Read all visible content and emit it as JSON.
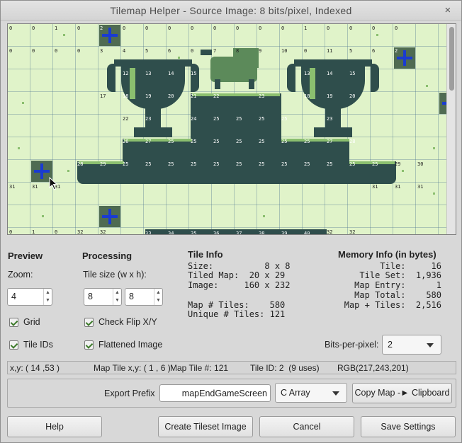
{
  "window": {
    "title": "Tilemap Helper  - Source Image: 8 bits/pixel, Indexed",
    "close_glyph": "×"
  },
  "preview": {
    "header": "Preview",
    "zoom_label": "Zoom:",
    "zoom_value": "4",
    "grid_label": "Grid",
    "grid_checked": true,
    "tile_ids_label": "Tile IDs",
    "tile_ids_checked": true
  },
  "processing": {
    "header": "Processing",
    "tile_size_label": "Tile size (w x h):",
    "tile_w": "8",
    "tile_h": "8",
    "check_flip_label": "Check Flip X/Y",
    "check_flip_checked": true,
    "flattened_label": "Flattened Image",
    "flattened_checked": true
  },
  "tile_info": {
    "header": "Tile Info",
    "lines": [
      "Size:          8 x 8",
      "Tiled Map:  20 x 29",
      "Image:     160 x 232",
      "",
      "Map # Tiles:    580",
      "Unique # Tiles: 121"
    ]
  },
  "memory_info": {
    "header": "Memory Info (in bytes)",
    "lines": [
      "Tile:     16",
      "Tile Set:  1,936",
      "Map Entry:      1",
      "Map Total:    580",
      "Map + Tiles:  2,516"
    ]
  },
  "bits_per_pixel": {
    "label": "Bits-per-pixel:",
    "value": "2"
  },
  "status": {
    "xy": "x,y: ( 14 ,53 )",
    "map_tile_xy": "Map Tile x,y: ( 1 , 6 )",
    "map_tile_num": "Map Tile #: 121",
    "tile_id": "Tile ID: 2  (9 uses)",
    "rgb": "RGB(217,243,201)"
  },
  "export": {
    "prefix_label": "Export Prefix",
    "prefix_value": "mapEndGameScreen",
    "format_value": "C Array",
    "copy_button": "Copy Map -► Clipboard"
  },
  "buttons": {
    "help": "Help",
    "create_tileset": "Create Tileset Image",
    "cancel": "Cancel",
    "save_settings": "Save Settings"
  },
  "tile_ids": {
    "row0": [
      "0",
      "0",
      "1",
      "0",
      "2",
      "0",
      "0",
      "0",
      "0",
      "0",
      "0",
      "0",
      "0",
      "1",
      "0",
      "0",
      "0",
      "0"
    ],
    "row1": [
      "0",
      "0",
      "0",
      "0",
      "3",
      "4",
      "5",
      "6",
      "0",
      "7",
      "8",
      "9",
      "10",
      "0",
      "11",
      "5",
      "6",
      "2"
    ],
    "row2_left": [
      "12",
      "13",
      "14",
      "15"
    ],
    "row2_right": [
      "13",
      "14",
      "15"
    ],
    "row3": [
      "17",
      "18",
      "19",
      "20",
      "21",
      "22",
      "23",
      "18",
      "19",
      "20"
    ],
    "row4": [
      "22",
      "23",
      "24",
      "25",
      "25",
      "25",
      "25",
      "23"
    ],
    "row5": [
      "26",
      "27",
      "25",
      "25",
      "25",
      "25",
      "25",
      "25",
      "25",
      "27",
      "28"
    ],
    "row6": [
      "28",
      "29",
      "25",
      "25",
      "25",
      "25",
      "25",
      "25",
      "25",
      "25",
      "25",
      "25",
      "25",
      "25",
      "29",
      "30"
    ],
    "row7": [
      "31",
      "31",
      "31",
      "31",
      "31",
      "31"
    ],
    "row8": [
      "0",
      "1",
      "0",
      "32",
      "32",
      "33",
      "34",
      "35",
      "36",
      "37",
      "38",
      "39",
      "40",
      "32",
      "32"
    ]
  },
  "colors": {
    "bg_light": "#e0f3c9",
    "tile_dark": "#2f4e4c",
    "tile_mid": "#5c8a5a",
    "tile_light": "#8bbf6f",
    "highlight_blue": "#1a3bd1"
  }
}
